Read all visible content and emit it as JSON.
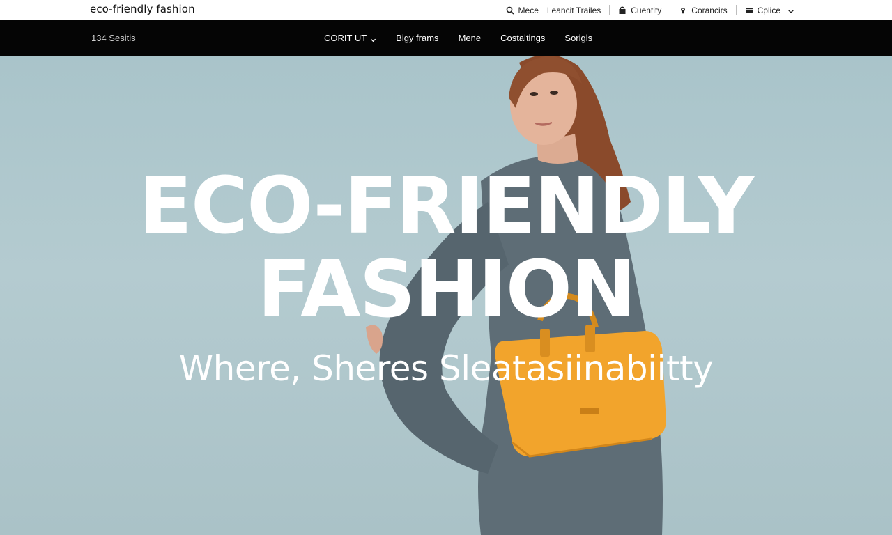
{
  "brand": "eco-friendly fashion",
  "utility_bar": {
    "items": [
      {
        "label": "Mece",
        "icon": "search-icon"
      },
      {
        "label": "Leancit Trailes",
        "icon": ""
      },
      {
        "label": "Cuentity",
        "icon": "bag-icon"
      },
      {
        "label": "Corancirs",
        "icon": "pin-icon"
      },
      {
        "label": "Cplice",
        "icon": "card-icon",
        "has_dropdown": true
      }
    ]
  },
  "nav": {
    "left_label": "134 Sesitis",
    "items": [
      {
        "label": "CORIT UT",
        "has_dropdown": true
      },
      {
        "label": "Bigy frams"
      },
      {
        "label": "Mene"
      },
      {
        "label": "Costaltings"
      },
      {
        "label": "Sorigls"
      }
    ]
  },
  "hero": {
    "title_line1": "ECO-FRIENDLY",
    "title_line2": "FASHION",
    "subtitle": "Where, Sheres Sleatasiinabiitty",
    "colors": {
      "background": "#b0c8cd",
      "coat": "#5e6d76",
      "bag": "#f2a42c",
      "hair": "#8a4a2b",
      "text": "#ffffff"
    }
  }
}
